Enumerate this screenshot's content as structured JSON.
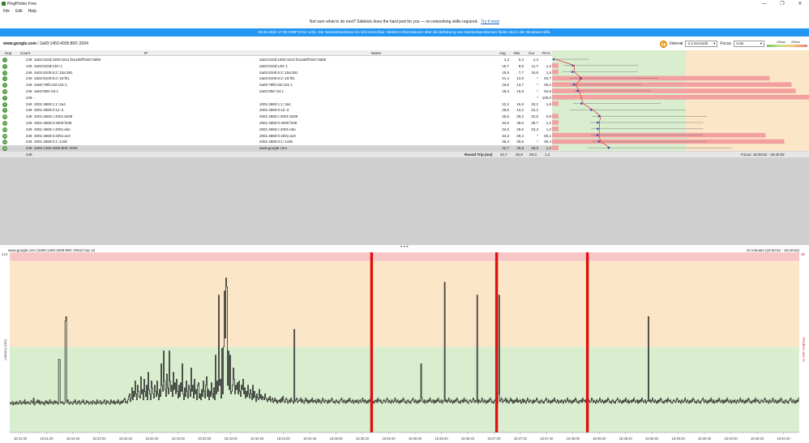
{
  "window": {
    "title": "PingPlotter Free",
    "controls": [
      "—",
      "❐",
      "✕"
    ]
  },
  "menu": [
    "File",
    "Edit",
    "Help"
  ],
  "promo": {
    "text": "Not sure what to do next? Sidekick does the hard part for you — no networking skills required.",
    "link": "Try it now!"
  },
  "infobar": "06.06.2022 17:06 ICMP Error 1231: Die Netzwerkadresse ist nicht erreichbar. Weitere Informationen über die Behebung von Netzwerkproblemen finden Sie in der Windows-Hilfe.",
  "toolbar": {
    "target_host": "www.google.com",
    "target_ip": " / 2a00:1450:4005:800::2004",
    "pause_icon": "pause-icon",
    "interval_label": "Interval",
    "interval_value": "2,4 seconds",
    "focus_label": "Focus",
    "focus_value": "Auto",
    "legend_low": "100ms",
    "legend_high": "200ms"
  },
  "table": {
    "headers": {
      "hop": "Hop",
      "count": "Count",
      "ip": "IP",
      "name": "Name",
      "avg": "Avg",
      "min": "Min",
      "cur": "Cur",
      "pl": "PL%",
      "latency_min": "0 ms",
      "latency": "Latency",
      "latency_max": "194 ms"
    },
    "rows": [
      {
        "hop": "1",
        "count": "249",
        "ip": "2a02:810d:1800:18c4:f2a185ff:fe87:8d90",
        "name": "2a02:810d:1800:18c4:f2a185ff:fe87:8d90",
        "avg": "1,3",
        "min": "0,4",
        "cur": "1,4",
        "pl": ""
      },
      {
        "hop": "2",
        "count": "249",
        "ip": "2a02:810d:130::1",
        "name": "2a02:810d:130::1",
        "avg": "15,7",
        "min": "8,8",
        "cur": "11,7",
        "pl": "1,2"
      },
      {
        "hop": "3",
        "count": "249",
        "ip": "2a02:8100:6:2::10a:381",
        "name": "2a02:8100:6:2::10a:381",
        "avg": "15,5",
        "min": "7,7",
        "cur": "19,9",
        "pl": "1,6"
      },
      {
        "hop": "4",
        "count": "249",
        "ip": "2a02:8100:6:2::16:f01",
        "name": "2a02:8100:6:2::16:f01",
        "avg": "21,4",
        "min": "12,9",
        "cur": "*",
        "pl": "84,7"
      },
      {
        "hop": "5",
        "count": "249",
        "ip": "2a00:79f0:c02:c01:1",
        "name": "2a00:79f0:c02:c01:1",
        "avg": "16,6",
        "min": "13,7",
        "cur": "*",
        "pl": "93,2"
      },
      {
        "hop": "6",
        "count": "249",
        "ip": "2a02:908::54:1",
        "name": "2a02:908::54:1",
        "avg": "19,3",
        "min": "16,8",
        "cur": "*",
        "pl": "94,8"
      },
      {
        "hop": "7",
        "count": "249",
        "ip": "-",
        "name": "",
        "avg": "",
        "min": "",
        "cur": "*",
        "pl": "100,0"
      },
      {
        "hop": "8",
        "count": "249",
        "ip": "2001:4860:1:1::2a4",
        "name": "2001:4860:1:1::2a4",
        "avg": "22,2",
        "min": "15,9",
        "cur": "20,2",
        "pl": "1,6"
      },
      {
        "hop": "9",
        "count": "249",
        "ip": "2001:4860:0:12::3",
        "name": "2001:4860:0:12::3",
        "avg": "29,5",
        "min": "13,2",
        "cur": "22,4",
        "pl": ""
      },
      {
        "hop": "10",
        "count": "249",
        "ip": "2001:4860:c:4001:5639",
        "name": "2001:4860:c:4001:5639",
        "avg": "35,5",
        "min": "30,2",
        "cur": "32,5",
        "pl": "0,8"
      },
      {
        "hop": "11",
        "count": "249",
        "ip": "2001:4860:0:4000:f438",
        "name": "2001:4860:0:4000:f438",
        "avg": "34,5",
        "min": "28,6",
        "cur": "38,7",
        "pl": "1,2"
      },
      {
        "hop": "12",
        "count": "249",
        "ip": "2001:4860:c:4001:ebe",
        "name": "2001:4860:c:4001:ebe",
        "avg": "34,5",
        "min": "29,5",
        "cur": "33,3",
        "pl": "1,2"
      },
      {
        "hop": "13",
        "count": "249",
        "ip": "2001:4860:0:4001:ac0",
        "name": "2001:4860:0:4001:ac0",
        "avg": "34,3",
        "min": "29,4",
        "cur": "*",
        "pl": "83,1"
      },
      {
        "hop": "14",
        "count": "249",
        "ip": "2001:4860:0:1::1c5b",
        "name": "2001:4860:0:1::1c5b",
        "avg": "35,3",
        "min": "30,5",
        "cur": "*",
        "pl": "90,4"
      },
      {
        "hop": "15",
        "count": "249",
        "ip": "2a00:1450:4005:800::2004",
        "name": "www.google.com",
        "avg": "42,7",
        "min": "26,9",
        "cur": "29,3",
        "pl": "1,2"
      }
    ],
    "summary": {
      "count": "249",
      "label": "Round Trip (ms)",
      "avg": "42,7",
      "min": "26,9",
      "cur": "29,3",
      "pl": "1,2",
      "focus": "Focus: 18:30:52 - 18:40:52"
    }
  },
  "timeline": {
    "header_left": "www.google.com (2a00:1450:4005:800::2004) hop 15",
    "header_right": "10 minutes (18:30:52 - 18:40:52)",
    "y_left_label": "Latency (ms)",
    "y_right_label": "Packet Loss %",
    "y_top_left": "210",
    "y_top_right": "30"
  },
  "colors": {
    "good": "#d9edcf",
    "warn": "#fce6c8",
    "bad": "#f7c7c7",
    "loss": "#e01010",
    "accent": "#2196f3"
  },
  "chart_data": {
    "type": "line",
    "title": "www.google.com (2a00:1450:4005:800::2004) hop 15",
    "ylabel": "Latency (ms)",
    "y2label": "Packet Loss %",
    "ylim": [
      0,
      210
    ],
    "zones": [
      {
        "from": 0,
        "to": 100,
        "color": "#d9edcf"
      },
      {
        "from": 100,
        "to": 200,
        "color": "#fce6c8"
      },
      {
        "from": 200,
        "to": 210,
        "color": "#f7c7c7"
      }
    ],
    "x_ticks": [
      "18:31:00",
      "18:31:20",
      "18:31:40",
      "18:32:00",
      "18:32:20",
      "18:32:40",
      "18:33:00",
      "18:33:20",
      "18:33:40",
      "18:34:00",
      "18:34:20",
      "18:34:40",
      "18:35:00",
      "18:35:20",
      "18:35:40",
      "18:36:00",
      "18:36:20",
      "18:36:40",
      "18:37:00",
      "18:37:20",
      "18:37:40",
      "18:38:00",
      "18:38:20",
      "18:38:40",
      "18:39:00",
      "18:39:20",
      "18:39:40",
      "18:40:00",
      "18:40:20",
      "18:40:40"
    ],
    "loss_events": [
      "18:35:27",
      "18:37:02",
      "18:38:11"
    ],
    "series": [
      {
        "values": [
          35,
          33,
          34,
          36,
          32,
          34,
          35,
          33,
          36,
          34,
          33,
          35,
          37,
          34,
          33,
          36,
          35,
          34,
          38,
          33,
          35,
          34,
          36,
          35,
          33,
          34,
          37,
          36,
          34,
          40,
          32,
          34,
          36,
          35,
          38,
          34,
          37,
          33,
          35,
          36,
          34,
          35,
          32,
          35,
          37,
          34,
          36,
          33,
          35,
          38,
          34,
          35,
          36,
          33,
          35,
          37,
          34,
          36,
          35,
          33,
          85,
          85,
          35,
          34,
          36,
          35,
          33,
          34,
          130,
          135,
          35,
          38,
          34,
          33,
          36,
          35,
          34,
          33,
          36,
          35,
          38,
          34,
          33,
          36,
          35,
          37,
          33,
          34,
          36,
          35,
          38,
          35,
          33,
          34,
          37,
          35,
          36,
          33,
          34,
          36,
          35,
          33,
          37,
          36,
          34,
          35,
          33,
          38,
          35,
          34,
          36,
          37,
          33,
          35,
          34,
          36,
          38,
          34,
          33,
          37,
          35,
          36,
          34,
          33,
          38,
          35,
          36,
          34,
          37,
          33,
          35,
          36,
          34,
          38,
          35,
          33,
          36,
          34,
          37,
          35,
          38,
          40,
          35,
          36,
          34,
          38,
          42,
          45,
          36,
          40,
          52,
          38,
          48,
          42,
          60,
          45,
          38,
          55,
          48,
          42,
          40,
          65,
          45,
          50,
          38,
          62,
          48,
          42,
          55,
          38,
          70,
          50,
          45,
          38,
          60,
          52,
          45,
          40,
          55,
          48,
          42,
          60,
          45,
          38,
          50,
          42,
          80,
          55,
          48,
          95,
          60,
          50,
          42,
          68,
          52,
          45,
          95,
          60,
          48,
          55,
          42,
          70,
          50,
          58,
          45,
          62,
          48,
          40,
          55,
          42,
          58,
          48,
          80,
          45,
          38,
          52,
          42,
          60,
          48,
          40,
          55,
          50,
          42,
          75,
          48,
          55,
          40,
          62,
          45,
          50,
          38,
          55,
          58,
          40,
          45,
          38,
          50,
          42,
          60,
          48,
          40,
          55,
          65,
          42,
          50,
          38,
          48,
          42,
          58,
          45,
          40,
          52,
          38,
          90,
          45,
          60,
          48,
          160,
          55,
          62,
          40,
          98,
          45,
          100,
          165,
          110,
          180,
          170,
          55,
          95,
          50,
          90,
          45,
          48,
          55,
          75,
          62,
          45,
          55,
          50,
          58,
          45,
          60,
          48,
          42,
          55,
          50,
          62,
          45,
          52,
          40,
          48,
          42,
          55,
          45,
          40,
          50,
          45,
          38,
          55,
          40,
          48,
          42,
          36,
          45,
          40,
          38,
          50,
          40,
          44,
          38,
          42,
          40,
          38,
          45,
          40,
          38,
          36,
          40,
          38,
          42,
          36,
          38,
          40,
          35,
          37,
          40,
          36,
          38,
          34,
          37,
          36,
          38,
          35,
          40,
          36,
          42,
          38,
          35,
          36,
          40,
          38,
          34,
          36,
          38,
          35,
          40,
          37,
          36,
          34,
          120,
          36,
          38,
          40,
          35,
          36,
          38,
          37,
          40,
          35,
          38,
          36,
          34,
          37,
          40,
          36,
          38,
          34,
          37,
          35,
          38,
          36,
          40,
          35,
          37,
          36,
          38,
          34,
          36,
          39,
          35,
          38,
          36,
          34,
          37,
          40,
          36,
          35,
          38,
          37,
          36,
          34,
          38,
          35,
          37,
          36,
          40,
          38,
          35,
          36,
          34,
          37,
          38,
          35,
          36,
          34,
          37,
          38,
          40,
          36,
          35,
          38,
          36,
          34,
          37,
          35,
          38,
          36,
          40,
          37,
          35,
          36,
          38,
          34,
          36,
          37,
          35,
          38,
          36,
          34,
          37,
          38,
          35,
          36,
          40,
          37,
          35,
          38,
          36,
          34,
          37,
          35,
          38,
          36,
          40,
          38,
          35,
          36,
          34,
          37,
          36,
          38,
          35,
          40,
          37,
          36,
          38,
          35,
          34,
          36,
          38,
          37,
          35,
          36,
          40,
          38,
          35,
          37,
          36,
          34,
          38,
          36,
          35,
          37,
          40,
          36,
          35,
          38,
          36,
          34,
          37,
          35,
          38,
          36,
          40,
          38,
          35,
          36,
          34,
          37,
          38,
          35,
          36,
          34,
          37,
          38,
          40,
          36,
          35,
          38,
          36,
          34,
          37,
          35,
          38,
          36,
          80,
          40,
          36,
          35,
          38,
          34,
          36,
          37,
          35,
          38,
          36,
          40,
          37,
          35,
          36,
          38,
          34,
          37,
          35,
          38,
          36,
          40,
          37,
          35,
          36,
          38,
          34,
          36,
          37,
          175,
          36,
          38,
          35,
          37,
          40,
          36,
          35,
          38,
          36,
          34,
          37,
          35,
          38,
          36,
          40,
          38,
          35,
          36,
          34,
          37,
          36,
          38,
          35,
          40,
          37,
          36,
          38,
          35,
          34,
          36,
          38,
          37,
          35,
          36,
          40,
          38,
          35,
          37,
          36,
          160,
          34,
          38,
          36,
          35,
          37,
          40,
          36,
          35,
          38,
          36,
          34,
          37,
          35,
          38,
          36,
          40,
          38,
          35,
          36,
          34,
          37,
          38,
          35,
          36,
          34,
          45,
          160,
          36,
          38,
          40,
          35,
          36,
          38,
          37,
          40,
          35,
          38,
          36,
          34,
          37,
          40,
          36,
          38,
          34,
          37,
          35,
          38,
          36,
          40,
          35,
          37,
          36,
          38,
          34,
          36,
          39,
          35,
          38,
          36,
          34,
          37,
          40,
          36,
          35,
          38,
          37,
          36,
          34,
          38,
          35,
          37,
          36,
          40,
          38,
          35,
          36,
          34,
          37,
          38,
          35,
          36,
          34,
          37,
          38,
          40,
          36,
          35,
          38,
          36,
          34,
          37,
          35,
          38,
          36,
          40,
          37,
          35,
          36,
          38,
          34,
          36,
          37,
          35,
          38,
          36,
          34,
          37,
          38,
          35,
          36,
          40,
          37,
          35,
          38,
          36,
          34,
          37,
          35,
          38,
          36,
          40,
          38,
          35,
          36,
          34,
          37,
          36,
          38,
          35,
          40,
          37,
          36,
          38,
          35,
          34,
          36,
          38,
          37,
          35,
          36,
          40,
          38,
          35,
          37,
          36,
          34,
          38,
          36,
          35,
          37,
          40,
          36,
          35,
          38,
          36,
          34,
          37,
          35,
          38,
          36,
          40,
          38,
          35,
          36,
          34,
          37,
          38,
          35,
          36,
          34,
          37,
          38,
          40,
          36,
          35,
          38,
          36,
          34,
          37,
          35,
          38,
          36,
          40,
          36,
          35,
          38,
          34,
          36,
          37,
          35,
          38,
          36,
          40,
          37,
          35,
          36,
          38,
          34,
          37,
          35,
          38,
          36,
          40,
          37,
          35,
          36,
          38,
          34,
          36,
          37,
          135,
          36,
          38,
          35,
          37,
          40,
          36,
          35,
          38,
          36,
          34,
          37,
          35,
          38,
          36,
          40,
          38,
          35,
          36,
          34,
          37,
          36,
          38,
          35,
          40,
          37,
          36,
          38,
          35,
          34,
          36,
          38,
          37,
          35,
          36,
          40,
          38,
          35,
          37,
          36,
          34,
          38,
          36,
          35,
          37,
          40,
          36,
          35,
          38,
          36,
          34,
          37,
          35,
          38,
          36,
          40,
          38,
          35,
          36,
          34,
          37,
          38,
          35,
          36,
          34,
          37,
          38,
          40,
          36,
          35,
          38,
          36,
          34,
          37,
          35,
          38,
          36,
          40,
          36,
          35,
          38,
          34,
          36,
          37,
          35,
          38,
          36,
          40,
          37,
          35,
          36,
          38,
          34,
          37,
          35,
          38,
          36,
          40,
          37,
          35,
          36,
          38,
          34,
          36,
          37,
          35,
          38,
          36,
          34,
          37,
          38,
          35,
          36,
          40,
          37,
          35,
          38,
          36,
          34,
          37,
          35,
          38,
          36,
          40,
          38,
          35,
          36,
          34,
          37,
          36,
          38,
          35,
          40,
          37,
          36,
          38,
          35,
          34,
          36,
          38,
          37,
          35,
          36,
          40,
          38,
          35,
          37,
          36,
          34,
          38,
          36,
          35,
          37,
          40,
          36,
          35,
          38,
          36,
          34,
          37,
          35,
          38,
          36,
          40,
          38,
          35,
          36,
          34,
          37,
          38,
          35,
          36,
          34,
          37,
          38,
          40,
          36,
          35,
          38,
          36,
          34,
          37,
          35,
          38,
          36,
          40
        ]
      }
    ]
  }
}
